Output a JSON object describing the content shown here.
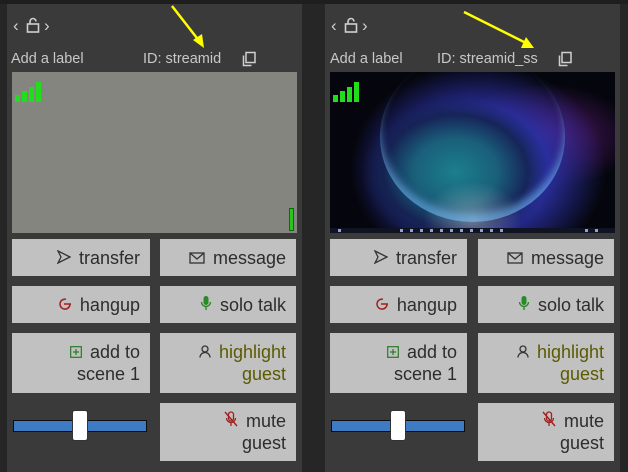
{
  "panels": [
    {
      "label_placeholder": "Add a label",
      "stream_id_text": "ID: streamid",
      "preview_type": "blank-gray",
      "buttons": {
        "transfer": "transfer",
        "message": "message",
        "hangup": "hangup",
        "solo_talk": "solo talk",
        "add_to_scene_line1": "add to",
        "add_to_scene_line2": "scene 1",
        "highlight_line1": "highlight",
        "highlight_line2": "guest",
        "mute_line1": "mute",
        "mute_line2": "guest"
      },
      "volume_level": 0.5
    },
    {
      "label_placeholder": "Add a label",
      "stream_id_text": "ID: streamid_ss",
      "preview_type": "screen-share",
      "buttons": {
        "transfer": "transfer",
        "message": "message",
        "hangup": "hangup",
        "solo_talk": "solo talk",
        "add_to_scene_line1": "add to",
        "add_to_scene_line2": "scene 1",
        "highlight_line1": "highlight",
        "highlight_line2": "guest",
        "mute_line1": "mute",
        "mute_line2": "guest"
      },
      "volume_level": 0.5
    }
  ],
  "icons": {
    "nav_left": "chevron-left-icon",
    "nav_lock": "lock-icon",
    "nav_right": "chevron-right-icon",
    "copy": "copy-icon",
    "transfer": "send-icon",
    "message": "envelope-icon",
    "hangup": "hangup-icon",
    "solo_talk": "microphone-icon",
    "add_to_scene": "plus-box-icon",
    "highlight": "person-icon",
    "mute": "muted-microphone-icon",
    "signal": "signal-bars-icon"
  },
  "colors": {
    "panel_bg": "#3a3a3a",
    "button_bg": "#c1c1c1",
    "signal_green": "#22dd1c",
    "annotation_arrow": "#ffff00",
    "slider_track": "#3d7bc4"
  }
}
